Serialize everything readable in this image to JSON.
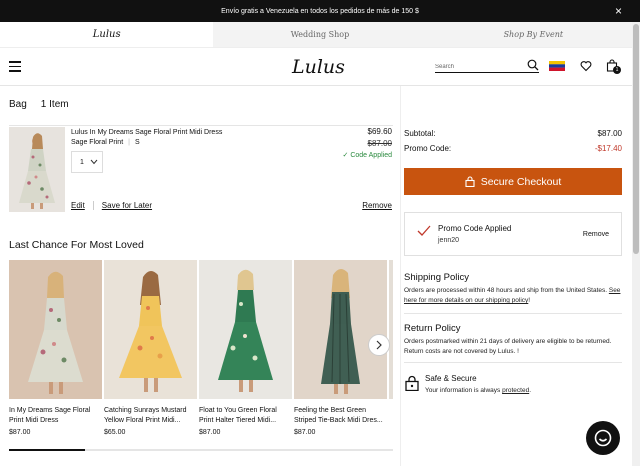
{
  "promo_bar": {
    "text": "Envío gratis a Venezuela en todos los pedidos de más de 150 $",
    "close": "×"
  },
  "brand_tabs": [
    {
      "label": "Lulus",
      "active": true
    },
    {
      "label": "Wedding Shop",
      "active": false
    },
    {
      "label": "Shop By Event",
      "active": false
    }
  ],
  "header": {
    "logo": "Lulus",
    "search": {
      "placeholder": "Search",
      "value": ""
    },
    "bag_count": "1",
    "icons": [
      "hamburger-menu-icon",
      "search-icon",
      "venezuela-flag-icon",
      "heart-icon",
      "shopping-bag-icon"
    ]
  },
  "bag": {
    "title": "Bag",
    "count": "1 Item",
    "item": {
      "name": "Lulus In My Dreams Sage Floral Print Midi Dress",
      "color": "Sage Floral Print",
      "size": "S",
      "qty": "1",
      "price_now": "$69.60",
      "price_was": "$87.00",
      "promo_label": "✓ Code Applied",
      "edit": "Edit",
      "save_later": "Save for Later",
      "remove": "Remove"
    }
  },
  "last_chance": {
    "title": "Last Chance For Most Loved",
    "products": [
      {
        "name": "In My Dreams Sage Floral Print Midi Dress",
        "price": "$87.00"
      },
      {
        "name": "Catching Sunrays Mustard Yellow Floral Print Midi...",
        "price": "$65.00"
      },
      {
        "name": "Float to You Green Floral Print Halter Tiered Midi...",
        "price": "$87.00"
      },
      {
        "name": "Feeling the Best Green Striped Tie-Back Midi Dres...",
        "price": "$87.00"
      }
    ],
    "next_arrow": "›"
  },
  "summary": {
    "subtotal_label": "Subtotal:",
    "subtotal_value": "$87.00",
    "promo_label": "Promo Code:",
    "promo_value": "-$17.40",
    "checkout_label": "Secure Checkout"
  },
  "promo_box": {
    "title": "Promo Code Applied",
    "code": "jenn20",
    "remove": "Remove"
  },
  "shipping_policy": {
    "title": "Shipping Policy",
    "text": "Orders are processed within 48 hours and ship from the United States. ",
    "link": "See here for more details on our shipping policy",
    "text_end": "!"
  },
  "return_policy": {
    "title": "Return Policy",
    "text": "Orders postmarked within 21 days of delivery are eligible to be returned. Return costs are not covered by Lulus. !"
  },
  "safe_secure": {
    "title": "Safe & Secure",
    "text": "Your information is always ",
    "link": "protected",
    "text_end": "."
  },
  "colors": {
    "checkout_button": "#c8540f",
    "promo_negative": "#c0392b",
    "code_applied": "#2a8a3e",
    "promo_bar_bg": "#111111"
  }
}
